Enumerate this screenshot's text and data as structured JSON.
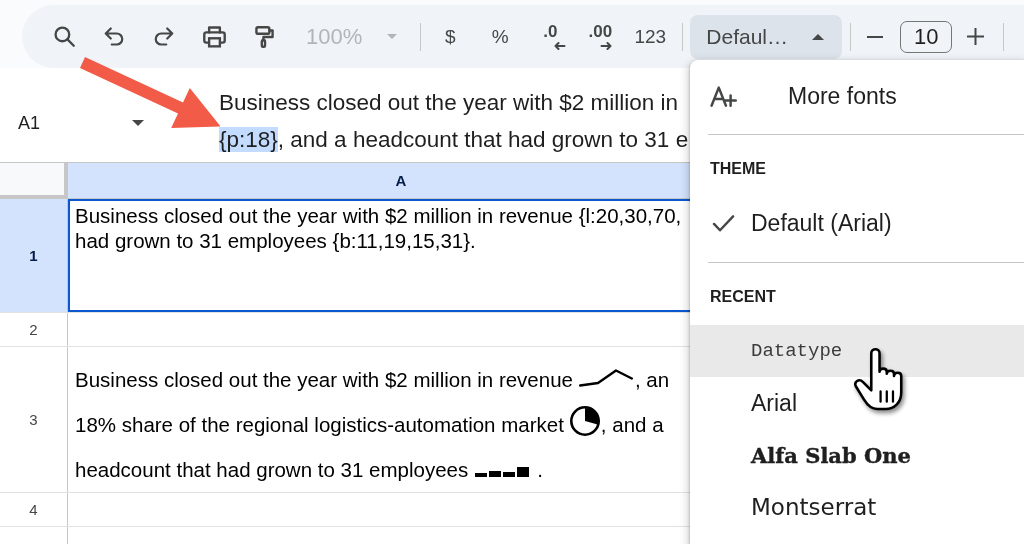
{
  "toolbar": {
    "zoom": {
      "label": "100%",
      "disabled": true
    },
    "format_buttons": [
      {
        "label": "$",
        "kind": "plain"
      },
      {
        "label": "%",
        "kind": "plain"
      },
      {
        "label": ".0",
        "kind": "decrease"
      },
      {
        "label": ".00",
        "kind": "increase"
      },
      {
        "label": "123",
        "kind": "plain"
      }
    ],
    "font": {
      "label": "Defaul…",
      "expanded": true
    },
    "font_size": {
      "value": "10"
    }
  },
  "formula_bar": {
    "cell_ref": "A1",
    "lines": [
      {
        "text": "Business closed out the year with $2 million in"
      },
      {
        "selected_text": "{p:18}",
        "text": ", and a headcount that had grown to 31 e"
      }
    ]
  },
  "grid": {
    "columns": [
      {
        "label": "A",
        "selected": true
      }
    ],
    "rows": [
      {
        "label": "1",
        "selected": true,
        "lines": [
          "Business closed out the year with $2 million in revenue {l:20,30,70,",
          "had grown to 31 employees {b:11,19,15,31}."
        ]
      },
      {
        "label": "2",
        "selected": false
      },
      {
        "label": "3",
        "selected": false,
        "rich_lines": [
          {
            "text": "Business closed out the year with $2 million in revenue",
            "kind": "line",
            "tail": ", an"
          },
          {
            "text": "18% share of the regional logistics-automation market",
            "kind": "pie",
            "tail": ", and a"
          },
          {
            "text": "headcount that had grown to 31 employees",
            "kind": "bar",
            "tail": "."
          }
        ]
      },
      {
        "label": "4",
        "selected": false
      }
    ]
  },
  "font_menu": {
    "more": {
      "label": "More fonts"
    },
    "sections": [
      {
        "title": "THEME",
        "items": [
          {
            "label": "Default (Arial)",
            "kind": "sans",
            "checked": true,
            "highlighted": false
          }
        ]
      },
      {
        "title": "RECENT",
        "items": [
          {
            "label": "Datatype",
            "kind": "mono",
            "checked": false,
            "highlighted": true
          },
          {
            "label": "Arial",
            "kind": "sans",
            "checked": false,
            "highlighted": false
          },
          {
            "label": "Alfa Slab One",
            "kind": "slab",
            "checked": false,
            "highlighted": false
          },
          {
            "label": "Montserrat",
            "kind": "geometric",
            "checked": false,
            "highlighted": false
          }
        ]
      }
    ]
  }
}
